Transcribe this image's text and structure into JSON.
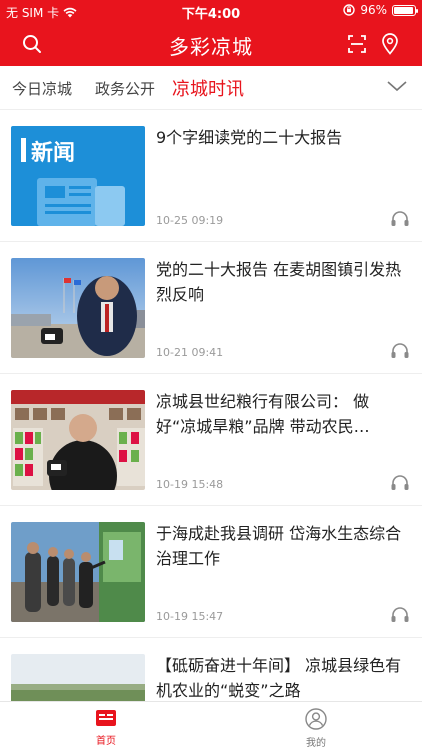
{
  "status": {
    "carrier": "无 SIM 卡",
    "time": "下午4:00",
    "battery": "96%"
  },
  "header": {
    "title": "多彩凉城"
  },
  "tabs": [
    {
      "label": "今日凉城",
      "active": false
    },
    {
      "label": "政务公开",
      "active": false
    },
    {
      "label": "凉城时讯",
      "active": true
    }
  ],
  "news": [
    {
      "title": "9个字细读党的二十大报告",
      "time": "10-25 09:19",
      "thumb_text": "新闻"
    },
    {
      "title": "党的二十大报告  在麦胡图镇引发热烈反响",
      "time": "10-21 09:41"
    },
    {
      "title": "凉城县世纪粮行有限公司：  做好“凉城旱粮”品牌  带动农民…",
      "time": "10-19 15:48"
    },
    {
      "title": "于海成赴我县调研  岱海水生态综合治理工作",
      "time": "10-19 15:47"
    },
    {
      "title": "【砥砺奋进十年间】  凉城县绿色有机农业的“蜕变”之路",
      "time": ""
    }
  ],
  "tabbar": {
    "home_label": "首页",
    "mine_label": "我的"
  },
  "colors": {
    "brand_red": "#e8141d",
    "text_gray": "#9a9a9a"
  }
}
